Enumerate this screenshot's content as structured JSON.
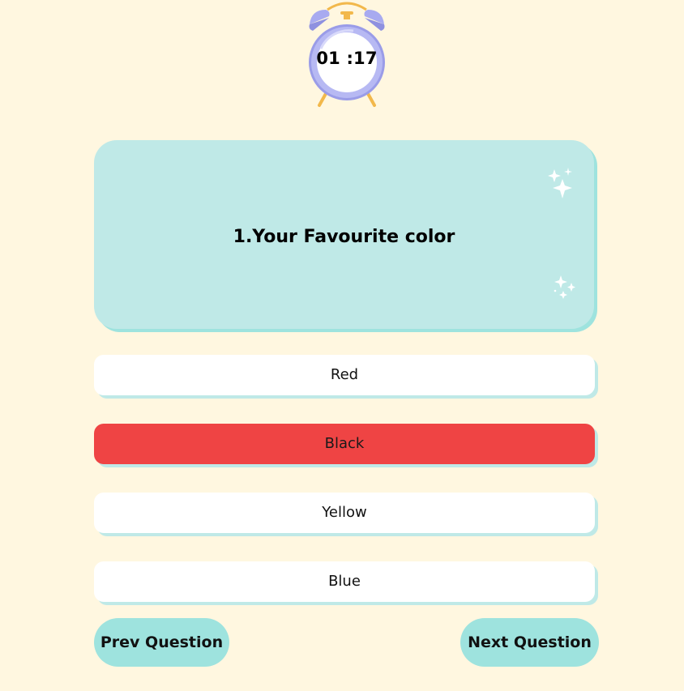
{
  "timer": {
    "display": "01 :17",
    "icon": "alarm-clock-icon"
  },
  "question": {
    "text": "1.Your Favourite color",
    "decoration_icon": "sparkle-icon"
  },
  "options": [
    {
      "label": "Red",
      "selected": false
    },
    {
      "label": "Black",
      "selected": true
    },
    {
      "label": "Yellow",
      "selected": false
    },
    {
      "label": "Blue",
      "selected": false
    }
  ],
  "navigation": {
    "prev_label": "Prev Question",
    "next_label": "Next Question"
  },
  "colors": {
    "background": "#fff7e0",
    "card": "#bfe9e7",
    "accent": "#9ee3de",
    "selected": "#ef4444",
    "clock": "#9a9ce8"
  }
}
